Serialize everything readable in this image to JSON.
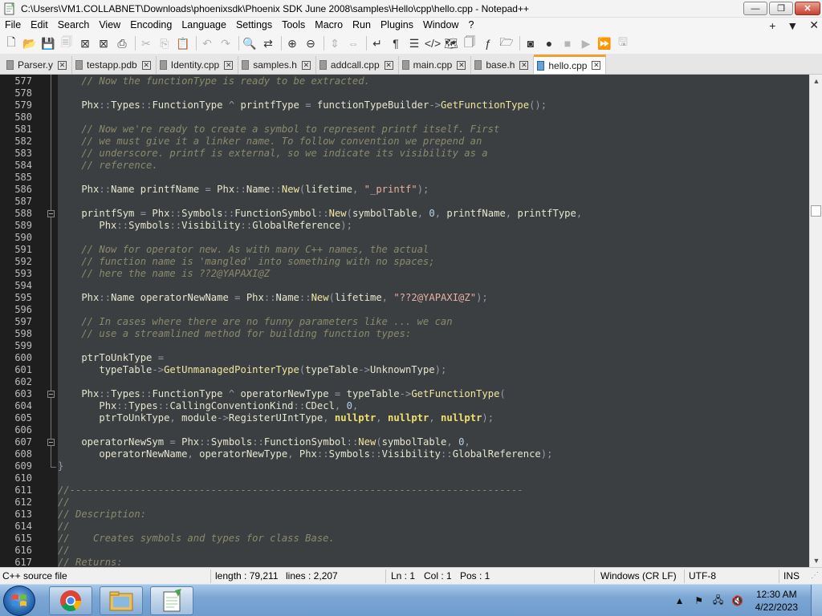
{
  "window": {
    "title": "C:\\Users\\VM1.COLLABNET\\Downloads\\phoenixsdk\\Phoenix SDK June 2008\\samples\\Hello\\cpp\\hello.cpp - Notepad++",
    "minimize": "—",
    "maximize": "❐",
    "close": "✕"
  },
  "menu": {
    "items": [
      "File",
      "Edit",
      "Search",
      "View",
      "Encoding",
      "Language",
      "Settings",
      "Tools",
      "Macro",
      "Run",
      "Plugins",
      "Window",
      "?"
    ],
    "right": [
      "+",
      "▼",
      "✕"
    ]
  },
  "toolbar": {
    "icons": [
      {
        "name": "new-file-icon",
        "glyph": "🗋",
        "enabled": true
      },
      {
        "name": "open-file-icon",
        "glyph": "📂",
        "enabled": true
      },
      {
        "name": "save-icon",
        "glyph": "💾",
        "enabled": false
      },
      {
        "name": "save-all-icon",
        "glyph": "🗐",
        "enabled": false
      },
      {
        "name": "close-icon",
        "glyph": "⊠",
        "enabled": true
      },
      {
        "name": "close-all-icon",
        "glyph": "⊠",
        "enabled": true
      },
      {
        "name": "print-icon",
        "glyph": "⎙",
        "enabled": true
      },
      {
        "name": "cut-icon",
        "glyph": "✂",
        "enabled": false
      },
      {
        "name": "copy-icon",
        "glyph": "⎘",
        "enabled": false
      },
      {
        "name": "paste-icon",
        "glyph": "📋",
        "enabled": false
      },
      {
        "name": "undo-icon",
        "glyph": "↶",
        "enabled": false
      },
      {
        "name": "redo-icon",
        "glyph": "↷",
        "enabled": false
      },
      {
        "name": "find-icon",
        "glyph": "🔍",
        "enabled": true
      },
      {
        "name": "replace-icon",
        "glyph": "⇄",
        "enabled": true
      },
      {
        "name": "zoom-in-icon",
        "glyph": "⊕",
        "enabled": true
      },
      {
        "name": "zoom-out-icon",
        "glyph": "⊖",
        "enabled": true
      },
      {
        "name": "sync-vertical-icon",
        "glyph": "⇕",
        "enabled": false
      },
      {
        "name": "sync-horizontal-icon",
        "glyph": "⇔",
        "enabled": false
      },
      {
        "name": "word-wrap-icon",
        "glyph": "↵",
        "enabled": true
      },
      {
        "name": "show-all-chars-icon",
        "glyph": "¶",
        "enabled": true
      },
      {
        "name": "indent-guide-icon",
        "glyph": "☰",
        "enabled": true
      },
      {
        "name": "xml-tag-icon",
        "glyph": "</>",
        "enabled": true
      },
      {
        "name": "document-map-icon",
        "glyph": "🗺",
        "enabled": true
      },
      {
        "name": "document-list-icon",
        "glyph": "🗍",
        "enabled": true
      },
      {
        "name": "function-list-icon",
        "glyph": "ƒ",
        "enabled": true
      },
      {
        "name": "folder-workspace-icon",
        "glyph": "🗁",
        "enabled": true
      },
      {
        "name": "monitoring-icon",
        "glyph": "◙",
        "enabled": true
      },
      {
        "name": "record-macro-icon",
        "glyph": "●",
        "enabled": true
      },
      {
        "name": "stop-macro-icon",
        "glyph": "■",
        "enabled": false
      },
      {
        "name": "play-macro-icon",
        "glyph": "▶",
        "enabled": false
      },
      {
        "name": "run-macro-multiple-icon",
        "glyph": "⏩",
        "enabled": false
      },
      {
        "name": "save-macro-icon",
        "glyph": "🖫",
        "enabled": false
      }
    ]
  },
  "tabs": [
    {
      "label": "Parser.y",
      "active": false
    },
    {
      "label": "testapp.pdb",
      "active": false
    },
    {
      "label": "Identity.cpp",
      "active": false
    },
    {
      "label": "samples.h",
      "active": false
    },
    {
      "label": "addcall.cpp",
      "active": false
    },
    {
      "label": "main.cpp",
      "active": false
    },
    {
      "label": "base.h",
      "active": false
    },
    {
      "label": "hello.cpp",
      "active": true
    }
  ],
  "editor": {
    "line_numbers": [
      "577",
      "578",
      "579",
      "580",
      "581",
      "582",
      "583",
      "584",
      "585",
      "586",
      "587",
      "588",
      "589",
      "590",
      "591",
      "592",
      "593",
      "594",
      "595",
      "596",
      "597",
      "598",
      "599",
      "600",
      "601",
      "602",
      "603",
      "604",
      "605",
      "606",
      "607",
      "608",
      "609",
      "610",
      "611",
      "612",
      "613",
      "614",
      "615",
      "616",
      "617"
    ],
    "lines": [
      [
        [
          "c-cm",
          "    // Now the functionType is ready to be extracted."
        ]
      ],
      [],
      [
        [
          "c-id",
          "    Phx"
        ],
        [
          "c-op",
          "::"
        ],
        [
          "c-id",
          "Types"
        ],
        [
          "c-op",
          "::"
        ],
        [
          "c-id",
          "FunctionType "
        ],
        [
          "c-op",
          "^ "
        ],
        [
          "c-id",
          "printfType "
        ],
        [
          "c-op",
          "= "
        ],
        [
          "c-id",
          "functionTypeBuilder"
        ],
        [
          "c-op",
          "->"
        ],
        [
          "c-fn",
          "GetFunctionType"
        ],
        [
          "c-op",
          "();"
        ]
      ],
      [],
      [
        [
          "c-cm",
          "    // Now we're ready to create a symbol to represent printf itself. First"
        ]
      ],
      [
        [
          "c-cm",
          "    // we must give it a linker name. To follow convention we prepend an"
        ]
      ],
      [
        [
          "c-cm",
          "    // underscore. printf is external, so we indicate its visibility as a"
        ]
      ],
      [
        [
          "c-cm",
          "    // reference."
        ]
      ],
      [],
      [
        [
          "c-id",
          "    Phx"
        ],
        [
          "c-op",
          "::"
        ],
        [
          "c-id",
          "Name printfName "
        ],
        [
          "c-op",
          "= "
        ],
        [
          "c-id",
          "Phx"
        ],
        [
          "c-op",
          "::"
        ],
        [
          "c-id",
          "Name"
        ],
        [
          "c-op",
          "::"
        ],
        [
          "c-fn",
          "New"
        ],
        [
          "c-op",
          "("
        ],
        [
          "c-id",
          "lifetime"
        ],
        [
          "c-op",
          ", "
        ],
        [
          "c-str",
          "\"_printf\""
        ],
        [
          "c-op",
          ");"
        ]
      ],
      [],
      [
        [
          "c-id",
          "    printfSym "
        ],
        [
          "c-op",
          "= "
        ],
        [
          "c-id",
          "Phx"
        ],
        [
          "c-op",
          "::"
        ],
        [
          "c-id",
          "Symbols"
        ],
        [
          "c-op",
          "::"
        ],
        [
          "c-id",
          "FunctionSymbol"
        ],
        [
          "c-op",
          "::"
        ],
        [
          "c-fn",
          "New"
        ],
        [
          "c-op",
          "("
        ],
        [
          "c-id",
          "symbolTable"
        ],
        [
          "c-op",
          ", "
        ],
        [
          "c-num",
          "0"
        ],
        [
          "c-op",
          ", "
        ],
        [
          "c-id",
          "printfName"
        ],
        [
          "c-op",
          ", "
        ],
        [
          "c-id",
          "printfType"
        ],
        [
          "c-op",
          ","
        ]
      ],
      [
        [
          "c-id",
          "       Phx"
        ],
        [
          "c-op",
          "::"
        ],
        [
          "c-id",
          "Symbols"
        ],
        [
          "c-op",
          "::"
        ],
        [
          "c-id",
          "Visibility"
        ],
        [
          "c-op",
          "::"
        ],
        [
          "c-id",
          "GlobalReference"
        ],
        [
          "c-op",
          ");"
        ]
      ],
      [],
      [
        [
          "c-cm",
          "    // Now for operator new. As with many C++ names, the actual"
        ]
      ],
      [
        [
          "c-cm",
          "    // function name is 'mangled' into something with no spaces;"
        ]
      ],
      [
        [
          "c-cm",
          "    // here the name is ??2@YAPAXI@Z"
        ]
      ],
      [],
      [
        [
          "c-id",
          "    Phx"
        ],
        [
          "c-op",
          "::"
        ],
        [
          "c-id",
          "Name operatorNewName "
        ],
        [
          "c-op",
          "= "
        ],
        [
          "c-id",
          "Phx"
        ],
        [
          "c-op",
          "::"
        ],
        [
          "c-id",
          "Name"
        ],
        [
          "c-op",
          "::"
        ],
        [
          "c-fn",
          "New"
        ],
        [
          "c-op",
          "("
        ],
        [
          "c-id",
          "lifetime"
        ],
        [
          "c-op",
          ", "
        ],
        [
          "c-str",
          "\"??2@YAPAXI@Z\""
        ],
        [
          "c-op",
          ");"
        ]
      ],
      [],
      [
        [
          "c-cm",
          "    // In cases where there are no funny parameters like ... we can"
        ]
      ],
      [
        [
          "c-cm",
          "    // use a streamlined method for building function types:"
        ]
      ],
      [],
      [
        [
          "c-id",
          "    ptrToUnkType "
        ],
        [
          "c-op",
          "="
        ]
      ],
      [
        [
          "c-id",
          "       typeTable"
        ],
        [
          "c-op",
          "->"
        ],
        [
          "c-fn",
          "GetUnmanagedPointerType"
        ],
        [
          "c-op",
          "("
        ],
        [
          "c-id",
          "typeTable"
        ],
        [
          "c-op",
          "->"
        ],
        [
          "c-id",
          "UnknownType"
        ],
        [
          "c-op",
          ");"
        ]
      ],
      [],
      [
        [
          "c-id",
          "    Phx"
        ],
        [
          "c-op",
          "::"
        ],
        [
          "c-id",
          "Types"
        ],
        [
          "c-op",
          "::"
        ],
        [
          "c-id",
          "FunctionType "
        ],
        [
          "c-op",
          "^ "
        ],
        [
          "c-id",
          "operatorNewType "
        ],
        [
          "c-op",
          "= "
        ],
        [
          "c-id",
          "typeTable"
        ],
        [
          "c-op",
          "->"
        ],
        [
          "c-fn",
          "GetFunctionType"
        ],
        [
          "c-op",
          "("
        ]
      ],
      [
        [
          "c-id",
          "       Phx"
        ],
        [
          "c-op",
          "::"
        ],
        [
          "c-id",
          "Types"
        ],
        [
          "c-op",
          "::"
        ],
        [
          "c-id",
          "CallingConventionKind"
        ],
        [
          "c-op",
          "::"
        ],
        [
          "c-id",
          "CDecl"
        ],
        [
          "c-op",
          ", "
        ],
        [
          "c-num",
          "0"
        ],
        [
          "c-op",
          ","
        ]
      ],
      [
        [
          "c-id",
          "       ptrToUnkType"
        ],
        [
          "c-op",
          ", "
        ],
        [
          "c-id",
          "module"
        ],
        [
          "c-op",
          "->"
        ],
        [
          "c-id",
          "RegisterUIntType"
        ],
        [
          "c-op",
          ", "
        ],
        [
          "c-kw",
          "nullptr"
        ],
        [
          "c-op",
          ", "
        ],
        [
          "c-kw",
          "nullptr"
        ],
        [
          "c-op",
          ", "
        ],
        [
          "c-kw",
          "nullptr"
        ],
        [
          "c-op",
          ");"
        ]
      ],
      [],
      [
        [
          "c-id",
          "    operatorNewSym "
        ],
        [
          "c-op",
          "= "
        ],
        [
          "c-id",
          "Phx"
        ],
        [
          "c-op",
          "::"
        ],
        [
          "c-id",
          "Symbols"
        ],
        [
          "c-op",
          "::"
        ],
        [
          "c-id",
          "FunctionSymbol"
        ],
        [
          "c-op",
          "::"
        ],
        [
          "c-fn",
          "New"
        ],
        [
          "c-op",
          "("
        ],
        [
          "c-id",
          "symbolTable"
        ],
        [
          "c-op",
          ", "
        ],
        [
          "c-num",
          "0"
        ],
        [
          "c-op",
          ","
        ]
      ],
      [
        [
          "c-id",
          "       operatorNewName"
        ],
        [
          "c-op",
          ", "
        ],
        [
          "c-id",
          "operatorNewType"
        ],
        [
          "c-op",
          ", "
        ],
        [
          "c-id",
          "Phx"
        ],
        [
          "c-op",
          "::"
        ],
        [
          "c-id",
          "Symbols"
        ],
        [
          "c-op",
          "::"
        ],
        [
          "c-id",
          "Visibility"
        ],
        [
          "c-op",
          "::"
        ],
        [
          "c-id",
          "GlobalReference"
        ],
        [
          "c-op",
          ");"
        ]
      ],
      [
        [
          "c-op",
          "}"
        ]
      ],
      [],
      [
        [
          "c-cm",
          "//-----------------------------------------------------------------------------"
        ]
      ],
      [
        [
          "c-cm",
          "//"
        ]
      ],
      [
        [
          "c-cm",
          "// Description:"
        ]
      ],
      [
        [
          "c-cm",
          "//"
        ]
      ],
      [
        [
          "c-cm",
          "//    Creates symbols and types for class Base."
        ]
      ],
      [
        [
          "c-cm",
          "//"
        ]
      ],
      [
        [
          "c-cm",
          "// Returns:"
        ]
      ]
    ]
  },
  "statusbar": {
    "language": "C++ source file",
    "length": "length : 79,211",
    "lines": "lines : 2,207",
    "ln": "Ln : 1",
    "col": "Col : 1",
    "pos": "Pos : 1",
    "eol": "Windows (CR LF)",
    "encoding": "UTF-8",
    "mode": "INS"
  },
  "taskbar": {
    "time": "12:30 AM",
    "date": "4/22/2023"
  }
}
